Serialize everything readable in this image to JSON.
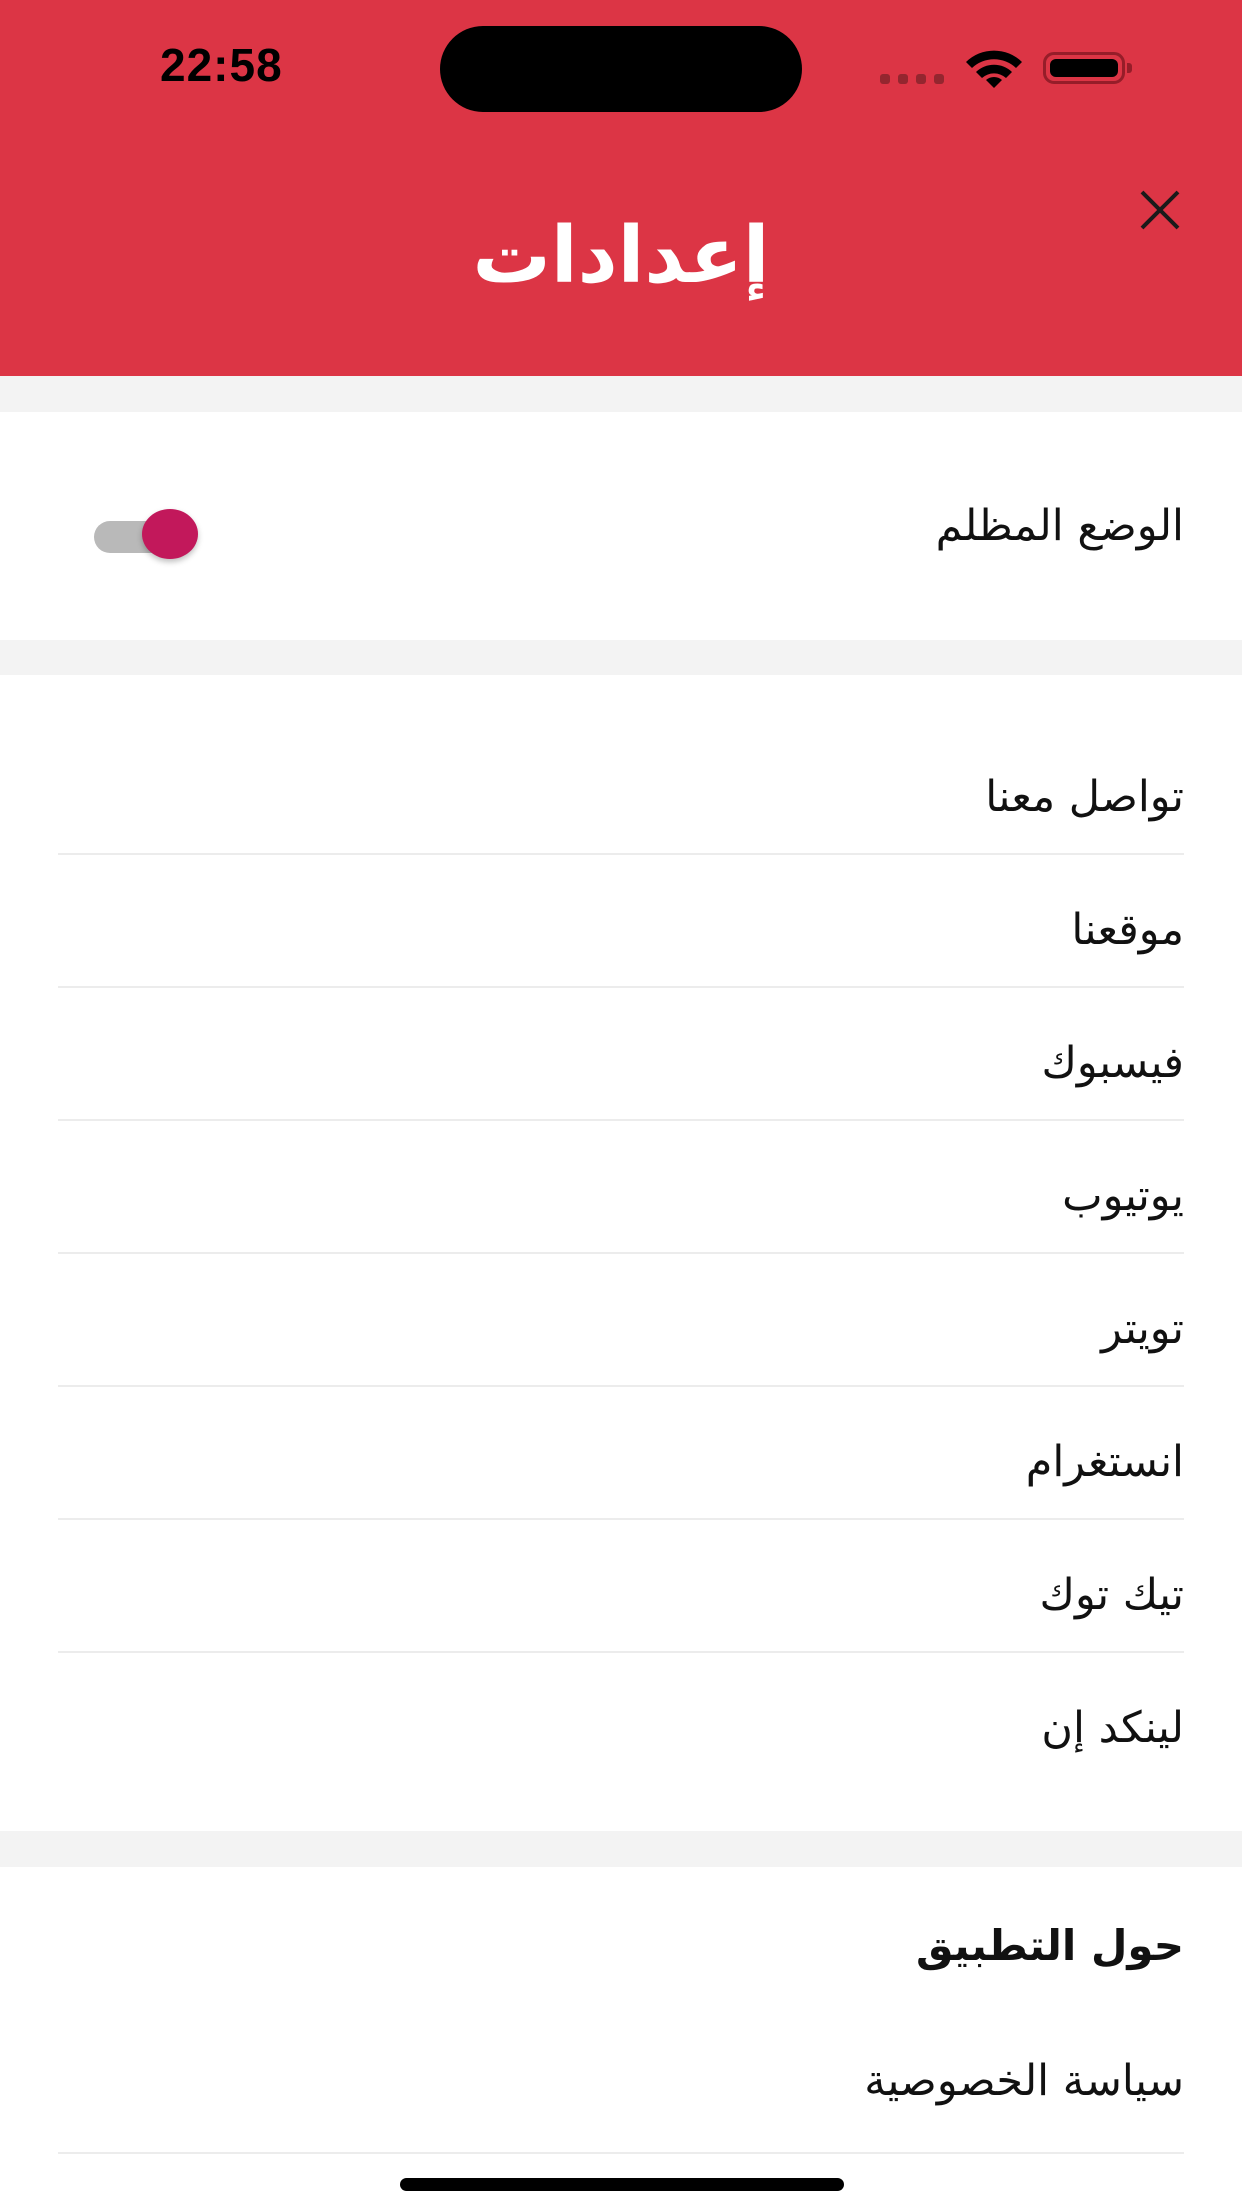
{
  "status_bar": {
    "time": "22:58"
  },
  "header": {
    "title": "إعدادات",
    "close_icon": "close-icon",
    "background": "#dc3545"
  },
  "dark_mode": {
    "label": "الوضع المظلم",
    "enabled": true,
    "toggle_color": "#c2185b"
  },
  "links": [
    {
      "label": "تواصل معنا"
    },
    {
      "label": "موقعنا"
    },
    {
      "label": "فيسبوك"
    },
    {
      "label": "يوتيوب"
    },
    {
      "label": "تويتر"
    },
    {
      "label": "انستغرام"
    },
    {
      "label": "تيك توك"
    },
    {
      "label": "لينكد إن"
    }
  ],
  "about": {
    "title": "حول التطبيق",
    "items": [
      {
        "label": "سياسة الخصوصية"
      }
    ]
  }
}
